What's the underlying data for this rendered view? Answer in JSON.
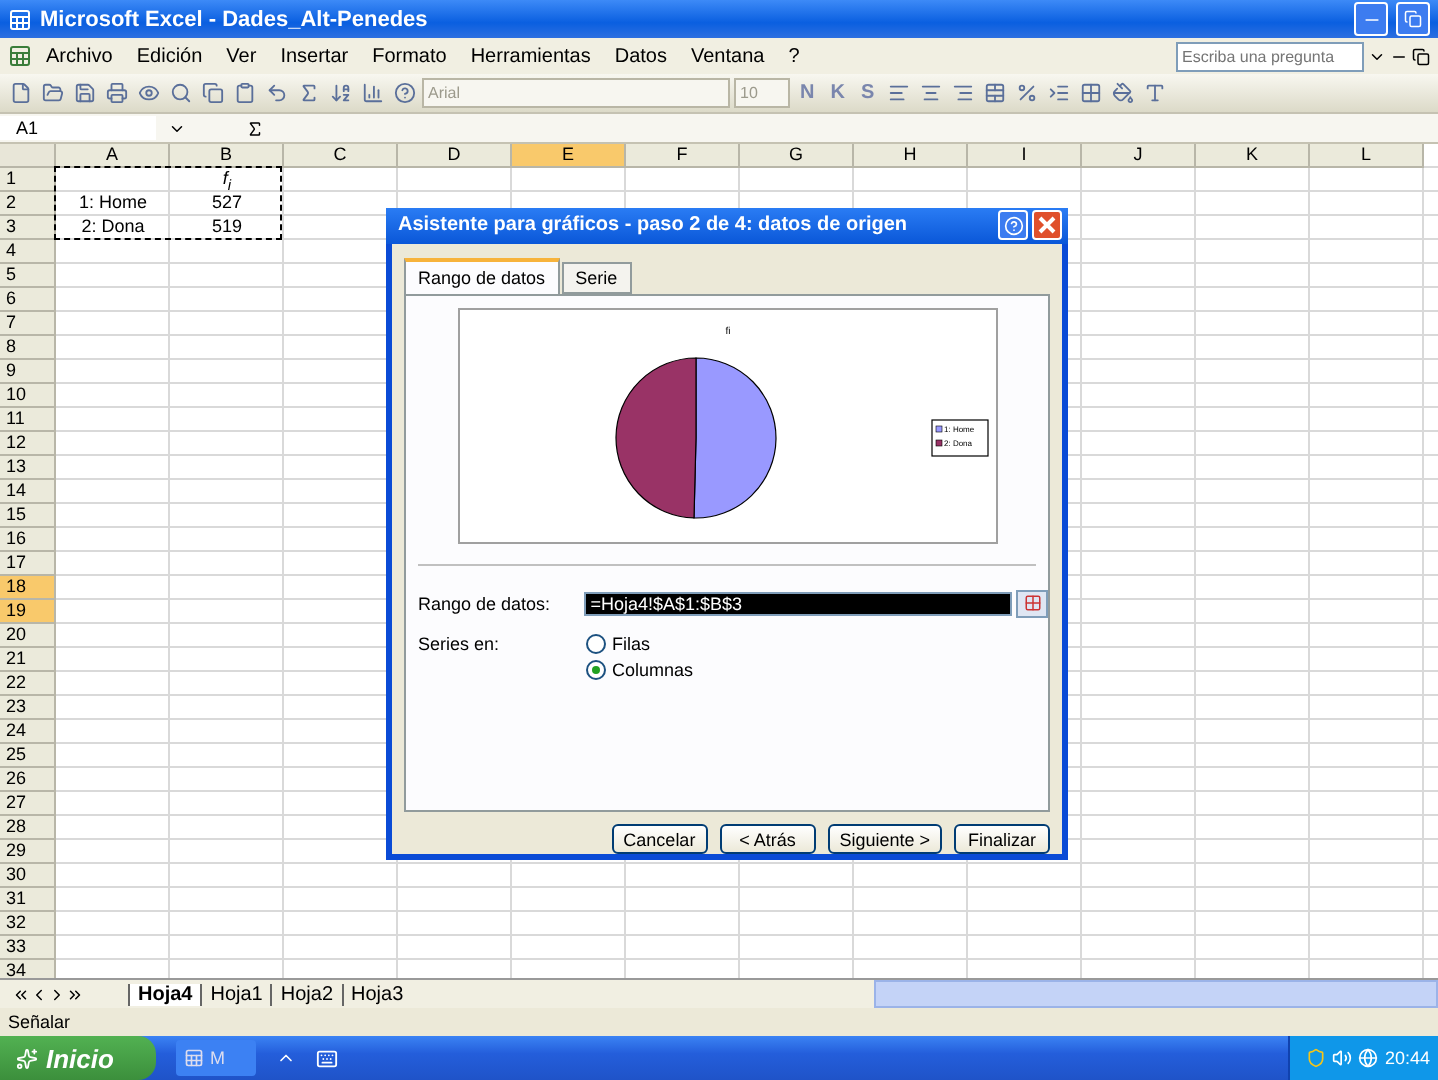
{
  "window": {
    "title": "Microsoft Excel - Dades_Alt-Penedes"
  },
  "menu": [
    "Archivo",
    "Edición",
    "Ver",
    "Insertar",
    "Formato",
    "Herramientas",
    "Datos",
    "Ventana",
    "?"
  ],
  "help_box": {
    "placeholder": "Escriba una pregunta"
  },
  "toolbar": {
    "font": "Arial",
    "size": "10",
    "format_buttons": [
      "N",
      "K",
      "S"
    ]
  },
  "name_box": "A1",
  "sheet": {
    "columns": [
      {
        "label": "A",
        "selected": false
      },
      {
        "label": "B",
        "selected": false
      },
      {
        "label": "C",
        "selected": false
      },
      {
        "label": "D",
        "selected": false
      },
      {
        "label": "E",
        "selected": true
      },
      {
        "label": "F",
        "selected": false
      },
      {
        "label": "G",
        "selected": false
      },
      {
        "label": "H",
        "selected": false
      },
      {
        "label": "I",
        "selected": false
      },
      {
        "label": "J",
        "selected": false
      },
      {
        "label": "K",
        "selected": false
      },
      {
        "label": "L",
        "selected": false
      }
    ],
    "rows": [
      {
        "label": "1",
        "selected": false,
        "marquee": true,
        "cells": [
          null,
          "f$_{i}$"
        ]
      },
      {
        "label": "2",
        "selected": false,
        "marquee": true,
        "cells": [
          "1: Home",
          "527"
        ]
      },
      {
        "label": "3",
        "selected": false,
        "marquee": true,
        "cells": [
          "2: Dona",
          "519"
        ]
      },
      {
        "label": "4",
        "selected": false
      },
      {
        "label": "5",
        "selected": false
      },
      {
        "label": "6",
        "selected": false
      },
      {
        "label": "7",
        "selected": false
      },
      {
        "label": "8",
        "selected": false
      },
      {
        "label": "9",
        "selected": false
      },
      {
        "label": "10",
        "selected": false
      },
      {
        "label": "11",
        "selected": false
      },
      {
        "label": "12",
        "selected": false
      },
      {
        "label": "13",
        "selected": false
      },
      {
        "label": "14",
        "selected": false
      },
      {
        "label": "15",
        "selected": false
      },
      {
        "label": "16",
        "selected": false
      },
      {
        "label": "17",
        "selected": false
      },
      {
        "label": "18",
        "selected": true
      },
      {
        "label": "19",
        "selected": true
      },
      {
        "label": "20",
        "selected": false
      },
      {
        "label": "21",
        "selected": false
      },
      {
        "label": "22",
        "selected": false
      },
      {
        "label": "23",
        "selected": false
      },
      {
        "label": "24",
        "selected": false
      },
      {
        "label": "25",
        "selected": false
      },
      {
        "label": "26",
        "selected": false
      },
      {
        "label": "27",
        "selected": false
      },
      {
        "label": "28",
        "selected": false
      },
      {
        "label": "29",
        "selected": false
      },
      {
        "label": "30",
        "selected": false
      },
      {
        "label": "31",
        "selected": false
      },
      {
        "label": "32",
        "selected": false
      },
      {
        "label": "33",
        "selected": false
      },
      {
        "label": "34",
        "selected": false
      }
    ]
  },
  "dialog": {
    "title": "Asistente para gráficos - paso 2 de 4: datos de origen",
    "tabs": [
      {
        "label": "Rango de datos",
        "selected": true
      },
      {
        "label": "Serie",
        "selected": false
      }
    ],
    "chart_data": {
      "type": "pie",
      "title": "fi",
      "categories": [
        "1: Home",
        "2: Dona"
      ],
      "values": [
        50.4,
        49.6
      ],
      "legend": "right"
    },
    "range": {
      "label": "Rango de datos:",
      "value": "=Hoja4!$A$1:$B$3"
    },
    "series_in": {
      "label": "Series en:",
      "options": [
        {
          "label": "Filas",
          "selected": false
        },
        {
          "label": "Columnas",
          "selected": true
        }
      ]
    },
    "buttons": [
      "Cancelar",
      "< Atrás",
      "Siguiente >",
      "Finalizar"
    ]
  },
  "sheet_tabs": [
    {
      "label": "Hoja4",
      "selected": true
    },
    {
      "label": "Hoja1",
      "selected": false
    },
    {
      "label": "Hoja2",
      "selected": false
    },
    {
      "label": "Hoja3",
      "selected": false
    }
  ],
  "status_bar": "Señalar",
  "taskbar": {
    "start": "Inicio",
    "tasks": [
      "M"
    ],
    "clock": "20:44"
  }
}
